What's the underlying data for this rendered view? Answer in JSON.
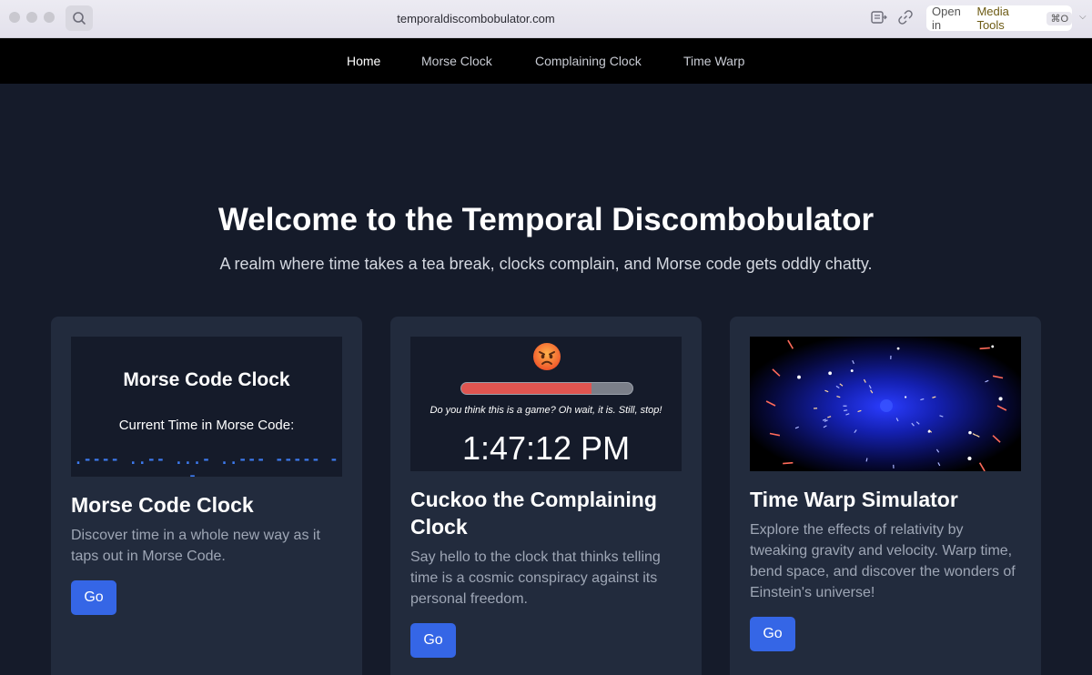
{
  "browser": {
    "url": "temporaldiscombobulator.com",
    "open_in_prefix": "Open in",
    "open_in_app": "Media Tools",
    "open_in_shortcut": "⌘O"
  },
  "nav": {
    "items": [
      {
        "label": "Home",
        "active": true
      },
      {
        "label": "Morse Clock"
      },
      {
        "label": "Complaining Clock"
      },
      {
        "label": "Time Warp"
      }
    ]
  },
  "hero": {
    "title": "Welcome to the Temporal Discombobulator",
    "subtitle": "A realm where time takes a tea break, clocks complain, and Morse code gets oddly chatty."
  },
  "cards": [
    {
      "media": {
        "title": "Morse Code Clock",
        "label": "Current Time in Morse Code:",
        "code": ".---- ..-- ...- ..--- ----- --..."
      },
      "title": "Morse Code Clock",
      "description": "Discover time in a whole new way as it taps out in Morse Code.",
      "button": "Go"
    },
    {
      "media": {
        "emoji": "angry-face",
        "progress": 0.76,
        "complaint": "Do you think this is a game? Oh wait, it is. Still, stop!",
        "time": "1:47:12 PM"
      },
      "title": "Cuckoo the Complaining Clock",
      "description": "Say hello to the clock that thinks telling time is a cosmic conspiracy against its personal freedom.",
      "button": "Go"
    },
    {
      "media": {
        "scene": "time-warp-starfield"
      },
      "title": "Time Warp Simulator",
      "description": "Explore the effects of relativity by tweaking gravity and velocity. Warp time, bend space, and discover the wonders of Einstein's universe!",
      "button": "Go"
    }
  ],
  "colors": {
    "page_bg": "#151b2a",
    "card_bg": "#222b3d",
    "button": "#3566e6",
    "morse": "#3d7bf0",
    "progress": "#e05550"
  }
}
